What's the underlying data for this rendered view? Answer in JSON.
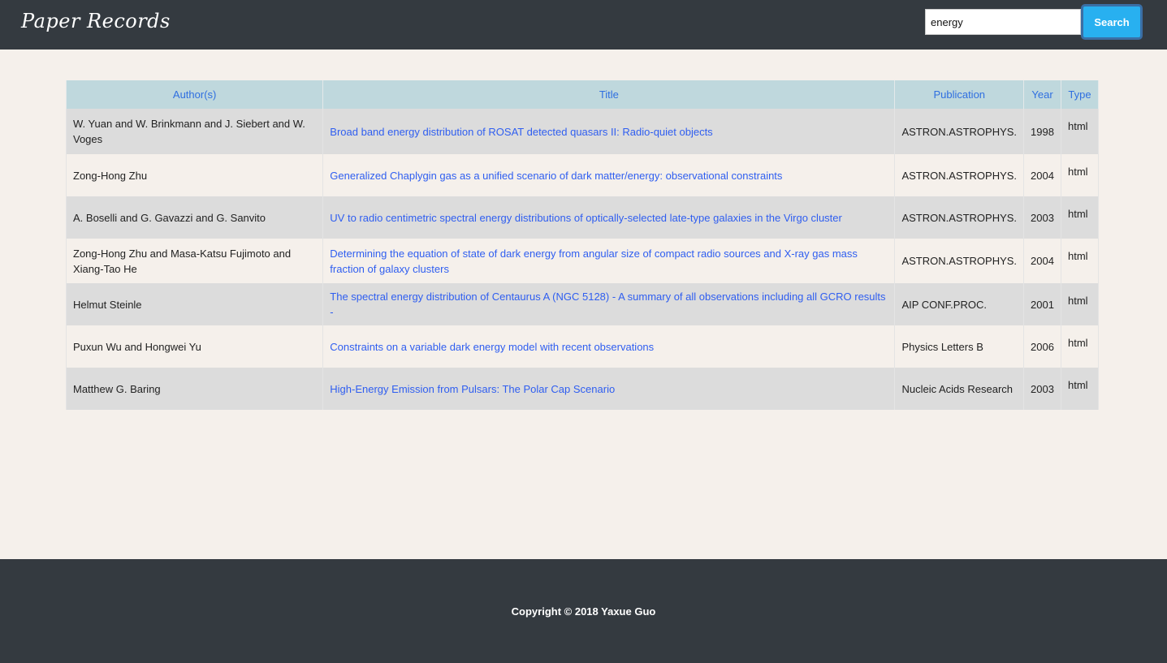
{
  "header": {
    "brand": "Paper Records",
    "search_value": "energy",
    "search_button": "Search"
  },
  "table": {
    "columns": [
      "Author(s)",
      "Title",
      "Publication",
      "Year",
      "Type"
    ],
    "rows": [
      {
        "authors": "W. Yuan and W. Brinkmann and J. Siebert and W. Voges",
        "title": "Broad band energy distribution of ROSAT detected quasars II: Radio-quiet objects",
        "publication": "ASTRON.ASTROPHYS.",
        "year": "1998",
        "type": "html"
      },
      {
        "authors": "Zong-Hong Zhu",
        "title": "Generalized Chaplygin gas as a unified scenario of dark matter/energy: observational constraints",
        "publication": "ASTRON.ASTROPHYS.",
        "year": "2004",
        "type": "html"
      },
      {
        "authors": "A. Boselli and G. Gavazzi and G. Sanvito",
        "title": "UV to radio centimetric spectral energy distributions of optically-selected late-type galaxies in the Virgo cluster",
        "publication": "ASTRON.ASTROPHYS.",
        "year": "2003",
        "type": "html"
      },
      {
        "authors": "Zong-Hong Zhu and Masa-Katsu Fujimoto and Xiang-Tao He",
        "title": "Determining the equation of state of dark energy from angular size of compact radio sources and X-ray gas mass fraction of galaxy clusters",
        "publication": "ASTRON.ASTROPHYS.",
        "year": "2004",
        "type": "html"
      },
      {
        "authors": "Helmut Steinle",
        "title": "The spectral energy distribution of Centaurus A (NGC 5128) - A summary of all observations including all GCRO results -",
        "publication": "AIP CONF.PROC.",
        "year": "2001",
        "type": "html"
      },
      {
        "authors": "Puxun Wu and Hongwei Yu",
        "title": "Constraints on a variable dark energy model with recent observations",
        "publication": "Physics Letters B",
        "year": "2006",
        "type": "html"
      },
      {
        "authors": "Matthew G. Baring",
        "title": "High-Energy Emission from Pulsars: The Polar Cap Scenario",
        "publication": "Nucleic Acids Research",
        "year": "2003",
        "type": "html"
      }
    ]
  },
  "footer": {
    "copyright": "Copyright © 2018 Yaxue Guo"
  }
}
